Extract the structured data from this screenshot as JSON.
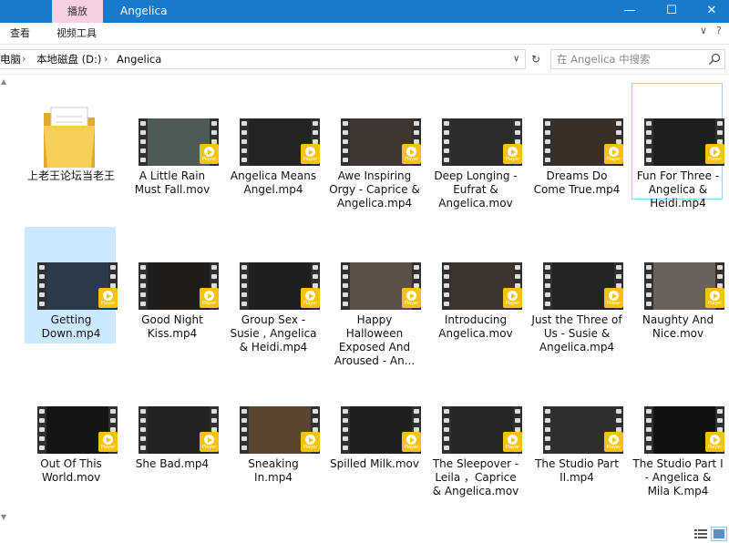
{
  "window": {
    "title": "Angelica",
    "contextual_tab": "播放",
    "minimize": "—",
    "maximize": "☐",
    "close": "✕"
  },
  "ribbon": {
    "tabs": [
      "查看",
      "视频工具"
    ],
    "collapse": "∨",
    "help": "?"
  },
  "address": {
    "crumbs": [
      "电脑",
      "本地磁盘 (D:)",
      "Angelica"
    ],
    "separator": "›"
  },
  "search": {
    "placeholder": "在 Angelica 中搜索"
  },
  "video_badge_text": "Player",
  "items": [
    {
      "name": "上老王论坛当老王",
      "type": "folder"
    },
    {
      "name": "A Little Rain Must Fall.mov",
      "type": "video",
      "tone": "#4d5a55"
    },
    {
      "name": "Angelica Means Angel.mp4",
      "type": "video",
      "tone": "#232323"
    },
    {
      "name": "Awe Inspiring Orgy - Caprice & Angelica.mp4",
      "type": "video",
      "tone": "#3e3530"
    },
    {
      "name": "Deep Longing - Eufrat & Angelica.mov",
      "type": "video",
      "tone": "#2c2c2c"
    },
    {
      "name": "Dreams Do Come True.mp4",
      "type": "video",
      "tone": "#3a2f26"
    },
    {
      "name": "Fun For Three - Angelica & Heidi.mp4",
      "type": "video",
      "tone": "#1e1e1e",
      "focused": true
    },
    {
      "name": "Getting Down.mp4",
      "type": "video",
      "tone": "#2b3a4a",
      "selected": true
    },
    {
      "name": "Good Night Kiss.mp4",
      "type": "video",
      "tone": "#201c1a"
    },
    {
      "name": "Group Sex - Susie , Angelica & Heidi.mp4",
      "type": "video",
      "tone": "#1f1f1f"
    },
    {
      "name": "Happy Halloween Exposed And Aroused - An...",
      "type": "video",
      "tone": "#5a5048"
    },
    {
      "name": "Introducing Angelica.mov",
      "type": "video",
      "tone": "#3d3430"
    },
    {
      "name": "Just the Three of Us - Susie & Angelica.mp4",
      "type": "video",
      "tone": "#232323"
    },
    {
      "name": "Naughty And Nice.mov",
      "type": "video",
      "tone": "#6a625a"
    },
    {
      "name": "Out Of This World.mov",
      "type": "video",
      "tone": "#151515"
    },
    {
      "name": "She Bad.mp4",
      "type": "video",
      "tone": "#222222"
    },
    {
      "name": "Sneaking In.mp4",
      "type": "video",
      "tone": "#5a4630"
    },
    {
      "name": "Spilled Milk.mov",
      "type": "video",
      "tone": "#1f1f1f"
    },
    {
      "name": "The Sleepover - Leila ，Caprice & Angelica.mov",
      "type": "video",
      "tone": "#262626"
    },
    {
      "name": "The Studio Part II.mp4",
      "type": "video",
      "tone": "#2e2e2e"
    },
    {
      "name": "The Studio Part I - Angelica & Mila K.mp4",
      "type": "video",
      "tone": "#111111"
    }
  ]
}
